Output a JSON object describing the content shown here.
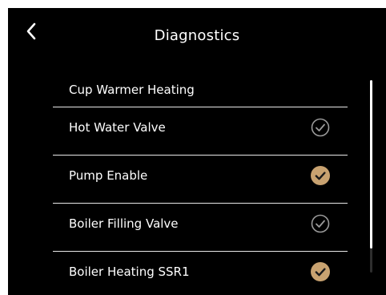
{
  "header": {
    "back_icon": "chevron-left-icon",
    "title": "Diagnostics"
  },
  "items": [
    {
      "label": "Cup Warmer Heating",
      "status": "none"
    },
    {
      "label": "Hot Water Valve",
      "status": "inactive",
      "icon": "check-circle-outline-icon"
    },
    {
      "label": "Pump Enable",
      "status": "active",
      "icon": "check-circle-filled-icon"
    },
    {
      "label": "Boiler Filling Valve",
      "status": "inactive",
      "icon": "check-circle-outline-icon"
    },
    {
      "label": "Boiler Heating SSR1",
      "status": "active",
      "icon": "check-circle-filled-icon"
    }
  ],
  "colors": {
    "background": "#000000",
    "text": "#ffffff",
    "check_active": "#c8a270",
    "check_inactive": "#9a9a9a",
    "divider": "#e8e8e8"
  },
  "scrollbar": {
    "position_fraction": 0.0,
    "visible_fraction": 0.87
  }
}
